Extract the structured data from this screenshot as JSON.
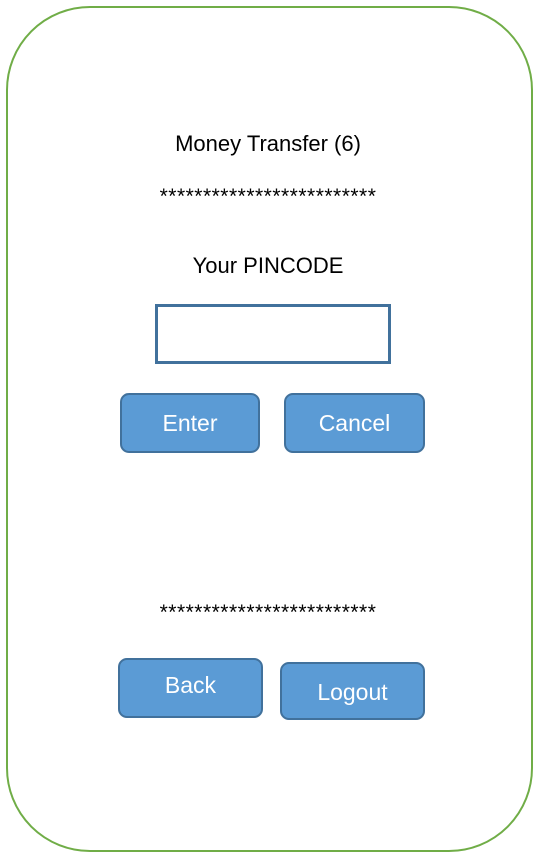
{
  "screen": {
    "title": "Money Transfer (6)",
    "separator": "*************************",
    "pin_label": "Your PINCODE",
    "pin_value": ""
  },
  "buttons": {
    "enter": "Enter",
    "cancel": "Cancel",
    "back": "Back",
    "logout": "Logout"
  },
  "colors": {
    "frame_border": "#70ad47",
    "button_fill": "#5b9bd5",
    "button_border": "#41719c",
    "input_border": "#41719c"
  }
}
